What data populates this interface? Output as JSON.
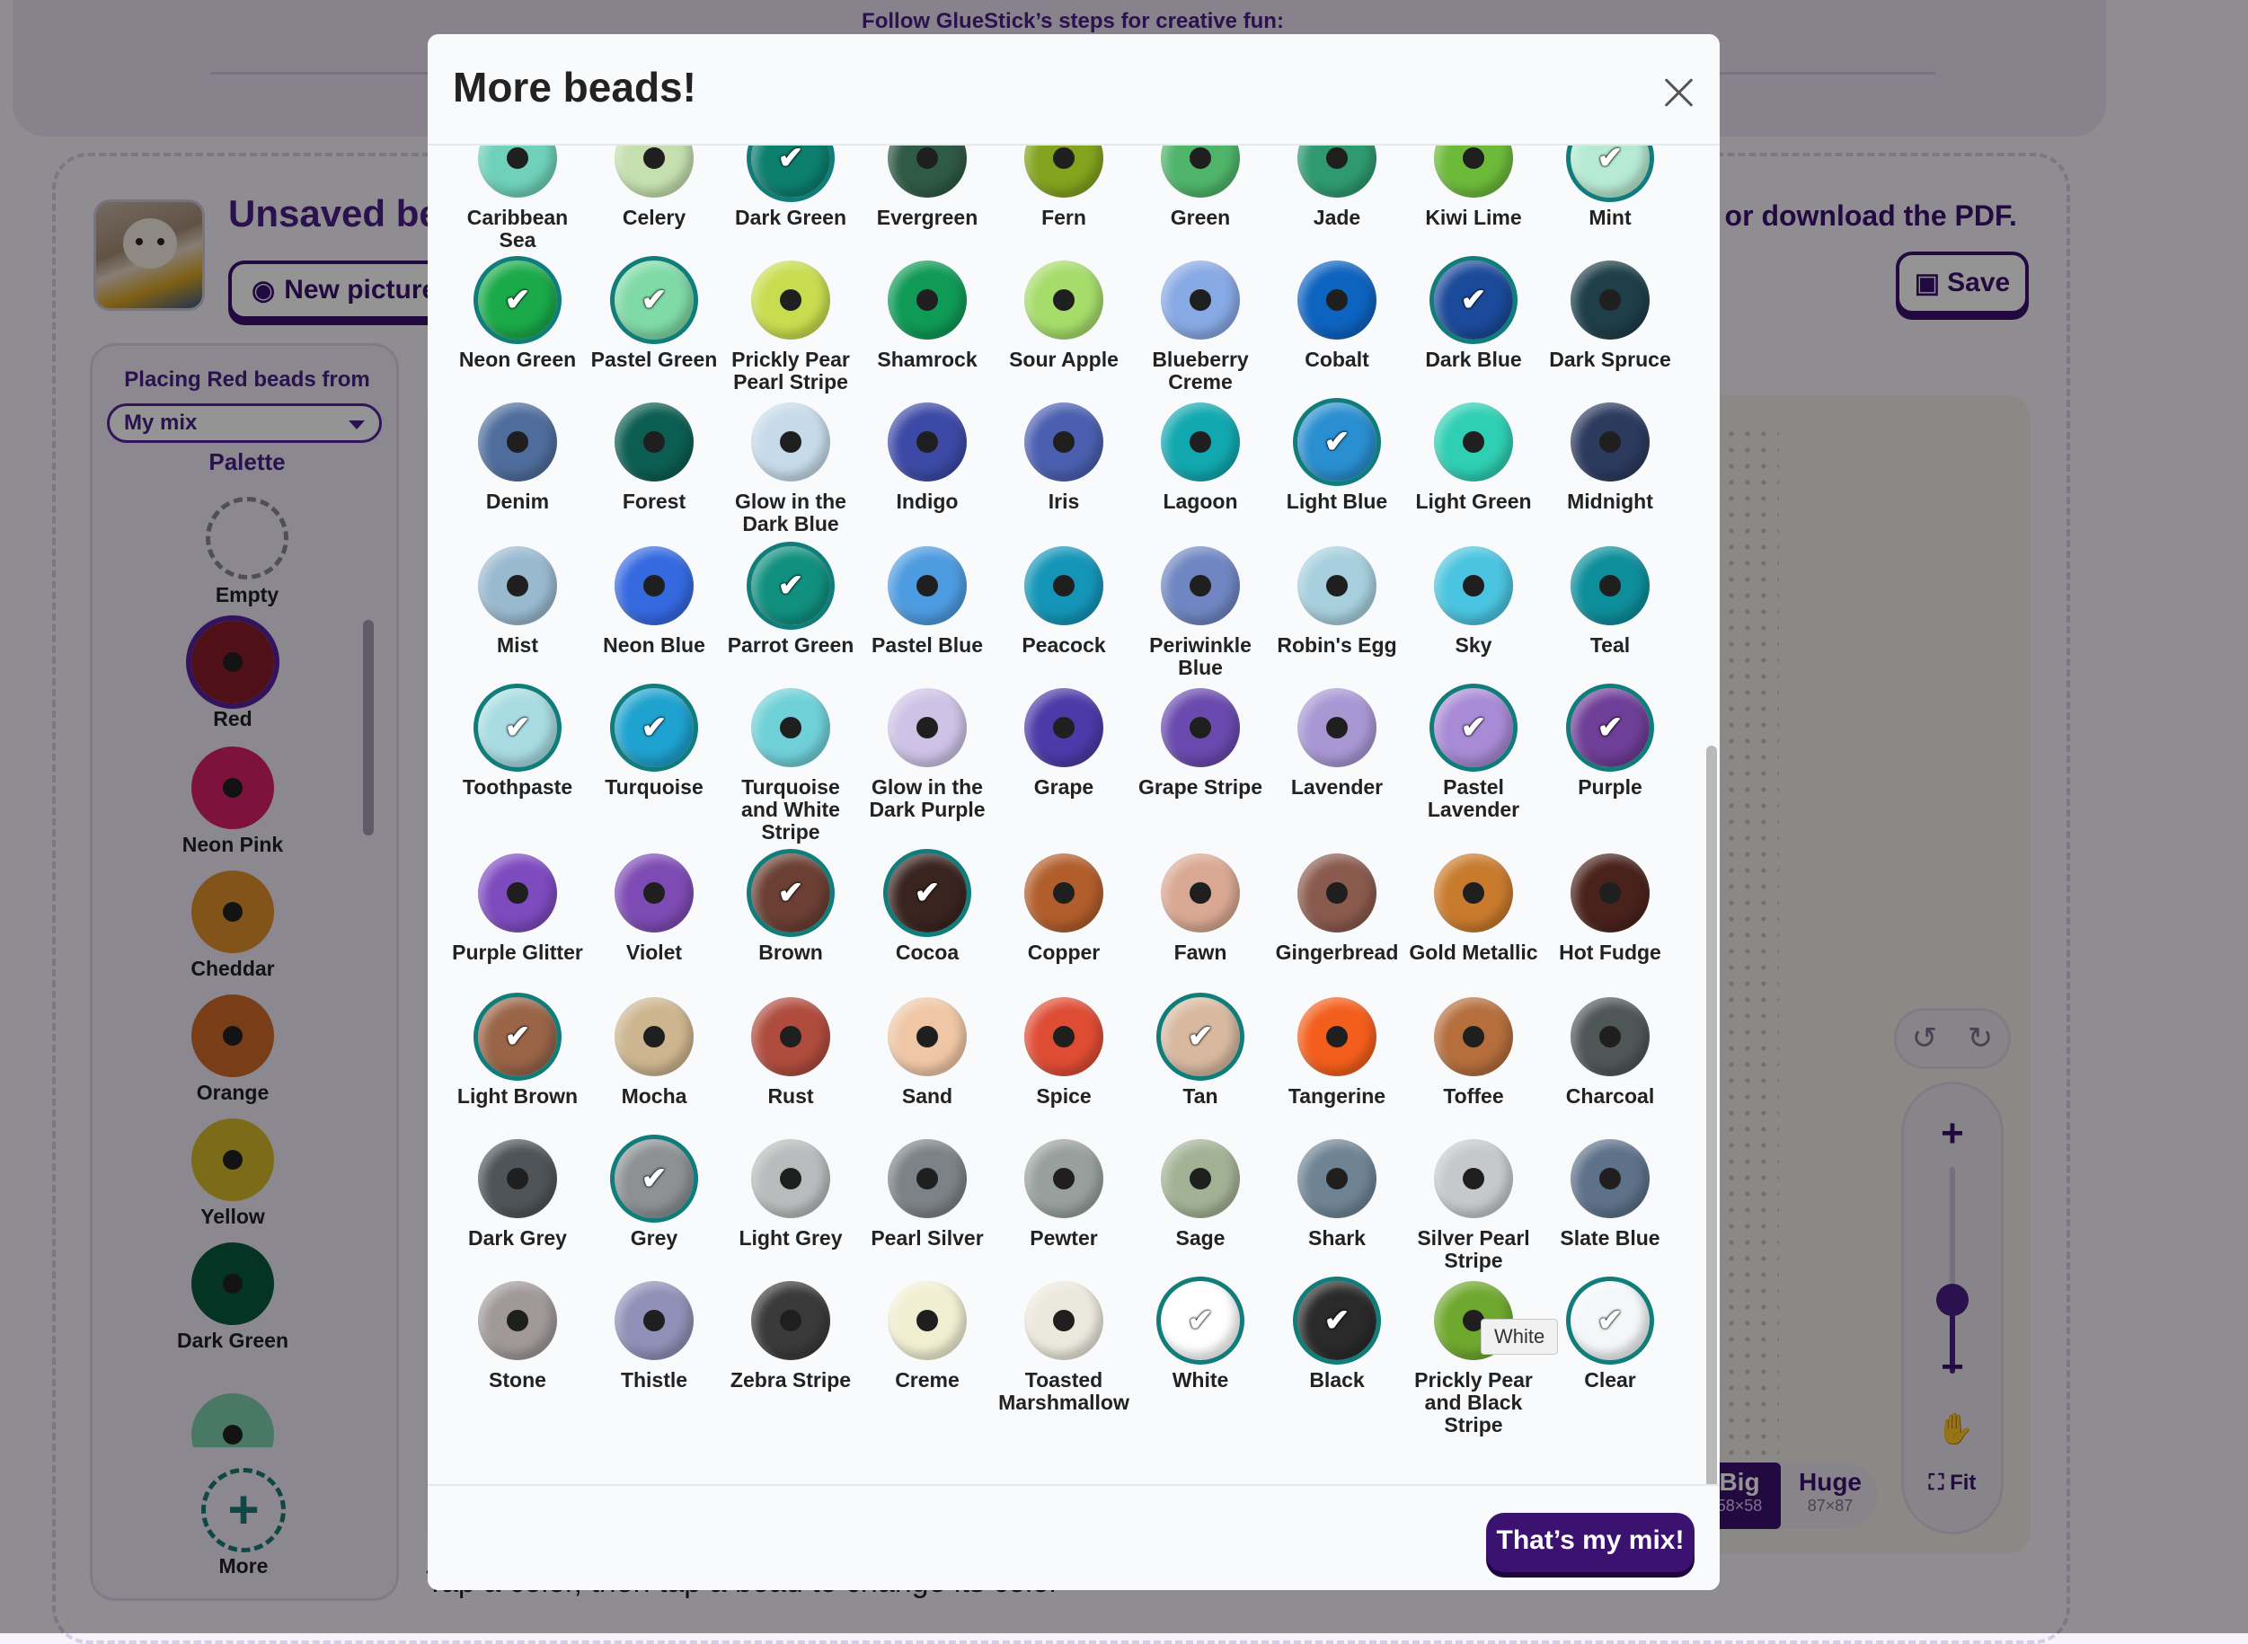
{
  "banner": {
    "text": "Follow GlueStick’s steps for creative fun:"
  },
  "project": {
    "title": "Unsaved bea",
    "new_picture_label": "New picture",
    "download_text": "t or download the PDF.",
    "save_label": "Save"
  },
  "palette_panel": {
    "placing_text": "Placing Red beads from",
    "mix_selected": "My mix",
    "palette_title": "Palette",
    "items": [
      {
        "label": "Empty"
      },
      {
        "label": "Red"
      },
      {
        "label": "Neon Pink"
      },
      {
        "label": "Cheddar"
      },
      {
        "label": "Orange"
      },
      {
        "label": "Yellow"
      },
      {
        "label": "Dark Green"
      }
    ],
    "more_label": "More"
  },
  "canvas": {
    "size_big": "Big",
    "size_big_dims": "58×58",
    "size_huge": "Huge",
    "size_huge_dims": "87×87",
    "fit_label": "Fit",
    "zoom_plus": "+",
    "zoom_minus": "−",
    "hint": "Tap a color, then tap a bead to change its color"
  },
  "modal": {
    "title": "More beads!",
    "tooltip": "White",
    "done_label": "That’s my mix!",
    "beads": [
      {
        "name": "Caribbean Sea",
        "color": "#6fd1b9",
        "selected": false
      },
      {
        "name": "Celery",
        "color": "#c5dfae",
        "selected": false
      },
      {
        "name": "Dark Green",
        "color": "#0d7f6d",
        "selected": true
      },
      {
        "name": "Evergreen",
        "color": "#2f5a45",
        "selected": false
      },
      {
        "name": "Fern",
        "color": "#84a31f",
        "selected": false
      },
      {
        "name": "Green",
        "color": "#4fb56a",
        "selected": false
      },
      {
        "name": "Jade",
        "color": "#2f9a70",
        "selected": false
      },
      {
        "name": "Kiwi Lime",
        "color": "#6dba3b",
        "selected": false
      },
      {
        "name": "Mint",
        "color": "#b7ead4",
        "selected": true
      },
      {
        "name": "Neon Green",
        "color": "#1aaa4a",
        "selected": true
      },
      {
        "name": "Pastel Green",
        "color": "#7fdaa6",
        "selected": true
      },
      {
        "name": "Prickly Pear Pearl Stripe",
        "color": "#c8dc4f",
        "selected": false
      },
      {
        "name": "Shamrock",
        "color": "#0f9a55",
        "selected": false
      },
      {
        "name": "Sour Apple",
        "color": "#a6dc6a",
        "selected": false
      },
      {
        "name": "Blueberry Creme",
        "color": "#87a9e4",
        "selected": false
      },
      {
        "name": "Cobalt",
        "color": "#0d63c0",
        "selected": false
      },
      {
        "name": "Dark Blue",
        "color": "#1b4a9a",
        "selected": true
      },
      {
        "name": "Dark Spruce",
        "color": "#1e3e48",
        "selected": false
      },
      {
        "name": "Denim",
        "color": "#4f6d9c",
        "selected": false
      },
      {
        "name": "Forest",
        "color": "#0c5e52",
        "selected": false
      },
      {
        "name": "Glow in the Dark Blue",
        "color": "#c6dbe9",
        "selected": false
      },
      {
        "name": "Indigo",
        "color": "#3c4aa6",
        "selected": false
      },
      {
        "name": "Iris",
        "color": "#4a5fb0",
        "selected": false
      },
      {
        "name": "Lagoon",
        "color": "#12a8b0",
        "selected": false
      },
      {
        "name": "Light Blue",
        "color": "#2a8fd0",
        "selected": true
      },
      {
        "name": "Light Green",
        "color": "#2fcfb3",
        "selected": false
      },
      {
        "name": "Midnight",
        "color": "#2c3a5e",
        "selected": false
      },
      {
        "name": "Mist",
        "color": "#99b9cf",
        "selected": false
      },
      {
        "name": "Neon Blue",
        "color": "#3569e0",
        "selected": false
      },
      {
        "name": "Parrot Green",
        "color": "#11907f",
        "selected": true
      },
      {
        "name": "Pastel Blue",
        "color": "#4d9be0",
        "selected": false
      },
      {
        "name": "Peacock",
        "color": "#1495b8",
        "selected": false
      },
      {
        "name": "Periwinkle Blue",
        "color": "#6f86c2",
        "selected": false
      },
      {
        "name": "Robin's Egg",
        "color": "#a7cfdd",
        "selected": false
      },
      {
        "name": "Sky",
        "color": "#4ac4e0",
        "selected": false
      },
      {
        "name": "Teal",
        "color": "#0d8e9a",
        "selected": false
      },
      {
        "name": "Toothpaste",
        "color": "#a8dce2",
        "selected": true
      },
      {
        "name": "Turquoise",
        "color": "#1ea2cf",
        "selected": true
      },
      {
        "name": "Turquoise and White Stripe",
        "color": "#6fd0d8",
        "selected": false
      },
      {
        "name": "Glow in the Dark Purple",
        "color": "#cec3e6",
        "selected": false
      },
      {
        "name": "Grape",
        "color": "#4c3aa8",
        "selected": false
      },
      {
        "name": "Grape Stripe",
        "color": "#6a4aae",
        "selected": false
      },
      {
        "name": "Lavender",
        "color": "#a997d4",
        "selected": false
      },
      {
        "name": "Pastel Lavender",
        "color": "#a98ad6",
        "selected": true
      },
      {
        "name": "Purple",
        "color": "#6f3e97",
        "selected": true
      },
      {
        "name": "Purple Glitter",
        "color": "#7e4bbf",
        "selected": false
      },
      {
        "name": "Violet",
        "color": "#7e4bb4",
        "selected": false
      },
      {
        "name": "Brown",
        "color": "#6b3f34",
        "selected": true
      },
      {
        "name": "Cocoa",
        "color": "#3a2420",
        "selected": true
      },
      {
        "name": "Copper",
        "color": "#b25e2c",
        "selected": false
      },
      {
        "name": "Fawn",
        "color": "#d9a892",
        "selected": false
      },
      {
        "name": "Gingerbread",
        "color": "#8a5a4e",
        "selected": false
      },
      {
        "name": "Gold Metallic",
        "color": "#c97b2d",
        "selected": false
      },
      {
        "name": "Hot Fudge",
        "color": "#4a221c",
        "selected": false
      },
      {
        "name": "Light Brown",
        "color": "#9a6448",
        "selected": true
      },
      {
        "name": "Mocha",
        "color": "#cdb58f",
        "selected": false
      },
      {
        "name": "Rust",
        "color": "#b04c3e",
        "selected": false
      },
      {
        "name": "Sand",
        "color": "#f0c7a6",
        "selected": false
      },
      {
        "name": "Spice",
        "color": "#df4c34",
        "selected": false
      },
      {
        "name": "Tan",
        "color": "#d8b9a0",
        "selected": true
      },
      {
        "name": "Tangerine",
        "color": "#f45e1c",
        "selected": false
      },
      {
        "name": "Toffee",
        "color": "#b56e3c",
        "selected": false
      },
      {
        "name": "Charcoal",
        "color": "#4f5656",
        "selected": false
      },
      {
        "name": "Dark Grey",
        "color": "#4e5458",
        "selected": false
      },
      {
        "name": "Grey",
        "color": "#8d9194",
        "selected": true
      },
      {
        "name": "Light Grey",
        "color": "#b9bcbc",
        "selected": false
      },
      {
        "name": "Pearl Silver",
        "color": "#7d8287",
        "selected": false
      },
      {
        "name": "Pewter",
        "color": "#98a09d",
        "selected": false
      },
      {
        "name": "Sage",
        "color": "#a3b294",
        "selected": false
      },
      {
        "name": "Shark",
        "color": "#6e8494",
        "selected": false
      },
      {
        "name": "Silver Pearl Stripe",
        "color": "#c6c8cb",
        "selected": false
      },
      {
        "name": "Slate Blue",
        "color": "#5d7188",
        "selected": false
      },
      {
        "name": "Stone",
        "color": "#a19898",
        "selected": false
      },
      {
        "name": "Thistle",
        "color": "#9090b8",
        "selected": false
      },
      {
        "name": "Zebra Stripe",
        "color": "#3a3a3a",
        "selected": false
      },
      {
        "name": "Creme",
        "color": "#f0efd2",
        "selected": false
      },
      {
        "name": "Toasted Marshmallow",
        "color": "#ebe8dc",
        "selected": false
      },
      {
        "name": "White",
        "color": "#ffffff",
        "selected": true
      },
      {
        "name": "Black",
        "color": "#2a2a2a",
        "selected": true
      },
      {
        "name": "Prickly Pear and Black Stripe",
        "color": "#6fa82e",
        "selected": false
      },
      {
        "name": "Clear",
        "color": "#f4f7f8",
        "selected": true
      }
    ]
  },
  "colors": {
    "accent": "#3b1270",
    "selection_ring": "#117d7a",
    "red_bead": "#8b1c28",
    "neon_pink_bead": "#d8206a",
    "cheddar_bead": "#e0922c",
    "orange_bead": "#d06a28",
    "yellow_bead": "#d6b82c",
    "dark_green_bead": "#0c5a3e"
  }
}
